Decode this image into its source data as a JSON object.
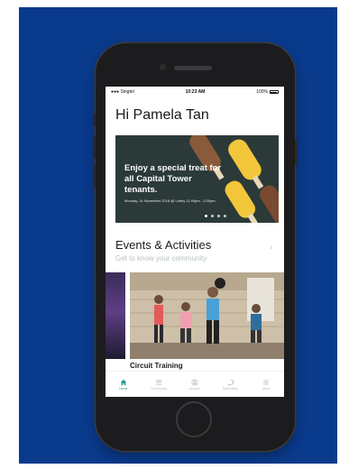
{
  "status_bar": {
    "carrier": "Singtel",
    "time": "10:23 AM",
    "battery": "100%"
  },
  "greeting": "Hi Pamela Tan",
  "promo": {
    "title": "Enjoy a special treat for all Capital Tower tenants.",
    "subtitle": "Monday, 14 November 2018 @ Lobby 11:00pm - 2:00pm",
    "slide_count": 4,
    "active_slide": 1
  },
  "events": {
    "title": "Events & Activities",
    "subtitle": "Get to know your community",
    "cards": [
      {
        "label": "Circuit Training"
      }
    ]
  },
  "tabbar": {
    "items": [
      {
        "label": "Home",
        "icon": "home-icon",
        "active": true
      },
      {
        "label": "Community",
        "icon": "community-icon",
        "active": false
      },
      {
        "label": "Account",
        "icon": "account-icon",
        "active": false
      },
      {
        "label": "Notification",
        "icon": "notification-icon",
        "active": false
      },
      {
        "label": "More",
        "icon": "menu-icon",
        "active": false
      }
    ]
  },
  "colors": {
    "backdrop": "#0a3a8c",
    "phone_body": "#1c1c1e",
    "accent": "#2a9d8f",
    "promo_bg": "#2b3a38",
    "popsicle": "#f2c63a"
  }
}
